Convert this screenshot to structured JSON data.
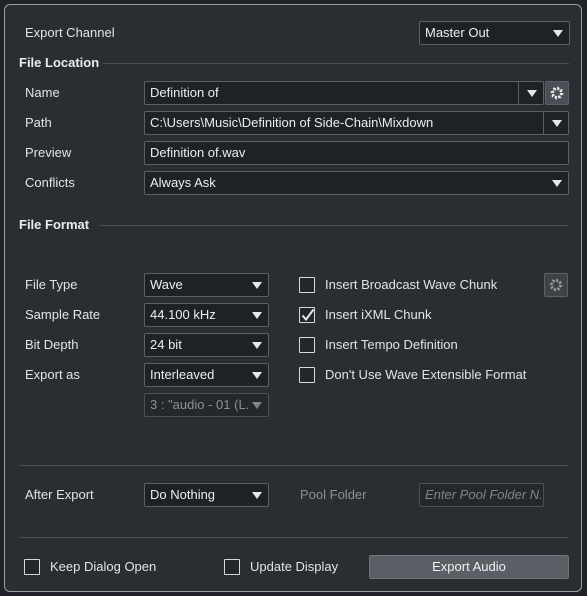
{
  "export_channel": {
    "label": "Export Channel",
    "value": "Master Out"
  },
  "file_location": {
    "title": "File Location",
    "name_label": "Name",
    "name_value": "Definition of",
    "path_label": "Path",
    "path_value": "C:\\Users\\Music\\Definition of Side-Chain\\Mixdown",
    "preview_label": "Preview",
    "preview_value": "Definition of.wav",
    "conflicts_label": "Conflicts",
    "conflicts_value": "Always Ask"
  },
  "file_format": {
    "title": "File Format",
    "file_type_label": "File Type",
    "file_type_value": "Wave",
    "sample_rate_label": "Sample Rate",
    "sample_rate_value": "44.100 kHz",
    "bit_depth_label": "Bit Depth",
    "bit_depth_value": "24 bit",
    "export_as_label": "Export as",
    "export_as_value": "Interleaved",
    "channel_value": "3 : \"audio - 01 (L.",
    "options": [
      {
        "label": "Insert Broadcast Wave Chunk",
        "checked": false
      },
      {
        "label": "Insert iXML Chunk",
        "checked": true
      },
      {
        "label": "Insert Tempo Definition",
        "checked": false
      },
      {
        "label": "Don't Use Wave Extensible Format",
        "checked": false
      }
    ]
  },
  "after_export": {
    "label": "After Export",
    "value": "Do Nothing",
    "pool_folder_label": "Pool Folder",
    "pool_folder_placeholder": "Enter Pool Folder N."
  },
  "footer": {
    "keep_dialog_open": "Keep Dialog Open",
    "update_display": "Update Display",
    "export_button": "Export Audio"
  },
  "icons": {
    "gear": "gear-icon",
    "dropdown": "chevron-down-icon",
    "check": "checkmark-icon"
  },
  "colors": {
    "background": "#2a2e33",
    "field": "#1e2125",
    "border": "#5b6168",
    "button": "#5a5f65"
  }
}
